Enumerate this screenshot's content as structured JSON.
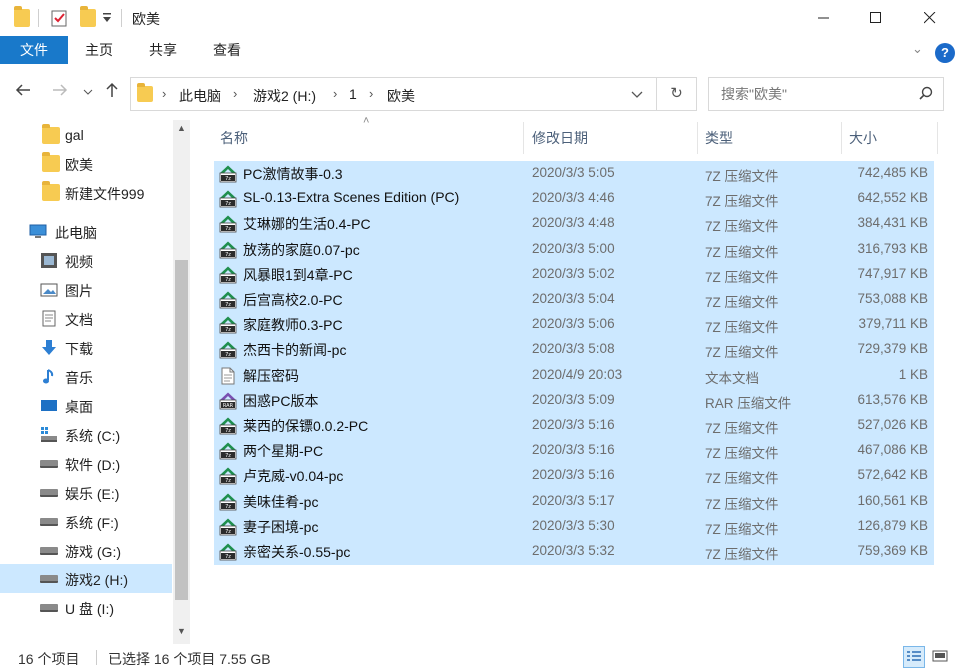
{
  "window": {
    "title": "欧美",
    "minimize_icon": "minimize-icon",
    "maximize_icon": "maximize-icon",
    "close_icon": "close-icon"
  },
  "ribbon": {
    "tabs": [
      {
        "label": "文件",
        "active": true
      },
      {
        "label": "主页"
      },
      {
        "label": "共享"
      },
      {
        "label": "查看"
      }
    ],
    "help_label": "?"
  },
  "address": {
    "crumbs": [
      "此电脑",
      "游戏2 (H:)",
      "1",
      "欧美"
    ],
    "search_placeholder": "搜索\"欧美\""
  },
  "navpane": {
    "items": [
      {
        "label": "gal",
        "icon": "folder-icon"
      },
      {
        "label": "欧美",
        "icon": "folder-icon"
      },
      {
        "label": "新建文件999",
        "icon": "folder-icon"
      },
      {
        "label": "此电脑",
        "icon": "computer-icon"
      },
      {
        "label": "视频",
        "icon": "video-icon"
      },
      {
        "label": "图片",
        "icon": "pictures-icon"
      },
      {
        "label": "文档",
        "icon": "documents-icon"
      },
      {
        "label": "下载",
        "icon": "download-icon"
      },
      {
        "label": "音乐",
        "icon": "music-icon"
      },
      {
        "label": "桌面",
        "icon": "desktop-icon"
      },
      {
        "label": "系统 (C:)",
        "icon": "system-drive-icon"
      },
      {
        "label": "软件 (D:)",
        "icon": "drive-icon"
      },
      {
        "label": "娱乐 (E:)",
        "icon": "drive-icon"
      },
      {
        "label": "系统 (F:)",
        "icon": "drive-icon"
      },
      {
        "label": "游戏 (G:)",
        "icon": "drive-icon"
      },
      {
        "label": "游戏2 (H:)",
        "icon": "drive-icon",
        "selected": true
      },
      {
        "label": "U 盘 (I:)",
        "icon": "drive-icon"
      }
    ]
  },
  "filelist": {
    "columns": [
      "名称",
      "修改日期",
      "类型",
      "大小"
    ],
    "rows": [
      {
        "name": "PC激情故事-0.3",
        "date": "2020/3/3 5:05",
        "type": "7Z 压缩文件",
        "size": "742,485 KB",
        "icon": "7z-archive-icon"
      },
      {
        "name": "SL-0.13-Extra Scenes Edition (PC)",
        "date": "2020/3/3 4:46",
        "type": "7Z 压缩文件",
        "size": "642,552 KB",
        "icon": "7z-archive-icon"
      },
      {
        "name": "艾琳娜的生活0.4-PC",
        "date": "2020/3/3 4:48",
        "type": "7Z 压缩文件",
        "size": "384,431 KB",
        "icon": "7z-archive-icon"
      },
      {
        "name": "放荡的家庭0.07-pc",
        "date": "2020/3/3 5:00",
        "type": "7Z 压缩文件",
        "size": "316,793 KB",
        "icon": "7z-archive-icon"
      },
      {
        "name": "风暴眼1到4章-PC",
        "date": "2020/3/3 5:02",
        "type": "7Z 压缩文件",
        "size": "747,917 KB",
        "icon": "7z-archive-icon"
      },
      {
        "name": "后宫高校2.0-PC",
        "date": "2020/3/3 5:04",
        "type": "7Z 压缩文件",
        "size": "753,088 KB",
        "icon": "7z-archive-icon"
      },
      {
        "name": "家庭教师0.3-PC",
        "date": "2020/3/3 5:06",
        "type": "7Z 压缩文件",
        "size": "379,711 KB",
        "icon": "7z-archive-icon"
      },
      {
        "name": "杰西卡的新闻-pc",
        "date": "2020/3/3 5:08",
        "type": "7Z 压缩文件",
        "size": "729,379 KB",
        "icon": "7z-archive-icon"
      },
      {
        "name": "解压密码",
        "date": "2020/4/9 20:03",
        "type": "文本文档",
        "size": "1 KB",
        "icon": "text-file-icon"
      },
      {
        "name": "困惑PC版本",
        "date": "2020/3/3 5:09",
        "type": "RAR 压缩文件",
        "size": "613,576 KB",
        "icon": "rar-archive-icon"
      },
      {
        "name": "莱西的保镖0.0.2-PC",
        "date": "2020/3/3 5:16",
        "type": "7Z 压缩文件",
        "size": "527,026 KB",
        "icon": "7z-archive-icon"
      },
      {
        "name": "两个星期-PC",
        "date": "2020/3/3 5:16",
        "type": "7Z 压缩文件",
        "size": "467,086 KB",
        "icon": "7z-archive-icon"
      },
      {
        "name": "卢克威-v0.04-pc",
        "date": "2020/3/3 5:16",
        "type": "7Z 压缩文件",
        "size": "572,642 KB",
        "icon": "7z-archive-icon"
      },
      {
        "name": "美味佳肴-pc",
        "date": "2020/3/3 5:17",
        "type": "7Z 压缩文件",
        "size": "160,561 KB",
        "icon": "7z-archive-icon"
      },
      {
        "name": "妻子困境-pc",
        "date": "2020/3/3 5:30",
        "type": "7Z 压缩文件",
        "size": "126,879 KB",
        "icon": "7z-archive-icon"
      },
      {
        "name": "亲密关系-0.55-pc",
        "date": "2020/3/3 5:32",
        "type": "7Z 压缩文件",
        "size": "759,369 KB",
        "icon": "7z-archive-icon"
      }
    ]
  },
  "status": {
    "item_count": "16 个项目",
    "selection": "已选择 16 个项目  7.55 GB"
  },
  "colors": {
    "selection": "#cce8ff",
    "file_tab": "#1979ca",
    "folder": "#f7cb52"
  }
}
